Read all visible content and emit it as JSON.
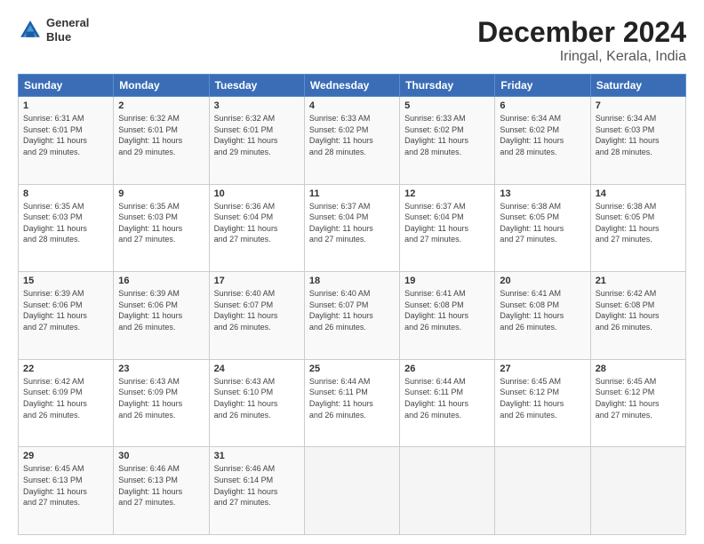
{
  "logo": {
    "line1": "General",
    "line2": "Blue"
  },
  "title": "December 2024",
  "subtitle": "Iringal, Kerala, India",
  "weekdays": [
    "Sunday",
    "Monday",
    "Tuesday",
    "Wednesday",
    "Thursday",
    "Friday",
    "Saturday"
  ],
  "weeks": [
    [
      {
        "day": "1",
        "info": "Sunrise: 6:31 AM\nSunset: 6:01 PM\nDaylight: 11 hours\nand 29 minutes."
      },
      {
        "day": "2",
        "info": "Sunrise: 6:32 AM\nSunset: 6:01 PM\nDaylight: 11 hours\nand 29 minutes."
      },
      {
        "day": "3",
        "info": "Sunrise: 6:32 AM\nSunset: 6:01 PM\nDaylight: 11 hours\nand 29 minutes."
      },
      {
        "day": "4",
        "info": "Sunrise: 6:33 AM\nSunset: 6:02 PM\nDaylight: 11 hours\nand 28 minutes."
      },
      {
        "day": "5",
        "info": "Sunrise: 6:33 AM\nSunset: 6:02 PM\nDaylight: 11 hours\nand 28 minutes."
      },
      {
        "day": "6",
        "info": "Sunrise: 6:34 AM\nSunset: 6:02 PM\nDaylight: 11 hours\nand 28 minutes."
      },
      {
        "day": "7",
        "info": "Sunrise: 6:34 AM\nSunset: 6:03 PM\nDaylight: 11 hours\nand 28 minutes."
      }
    ],
    [
      {
        "day": "8",
        "info": "Sunrise: 6:35 AM\nSunset: 6:03 PM\nDaylight: 11 hours\nand 28 minutes."
      },
      {
        "day": "9",
        "info": "Sunrise: 6:35 AM\nSunset: 6:03 PM\nDaylight: 11 hours\nand 27 minutes."
      },
      {
        "day": "10",
        "info": "Sunrise: 6:36 AM\nSunset: 6:04 PM\nDaylight: 11 hours\nand 27 minutes."
      },
      {
        "day": "11",
        "info": "Sunrise: 6:37 AM\nSunset: 6:04 PM\nDaylight: 11 hours\nand 27 minutes."
      },
      {
        "day": "12",
        "info": "Sunrise: 6:37 AM\nSunset: 6:04 PM\nDaylight: 11 hours\nand 27 minutes."
      },
      {
        "day": "13",
        "info": "Sunrise: 6:38 AM\nSunset: 6:05 PM\nDaylight: 11 hours\nand 27 minutes."
      },
      {
        "day": "14",
        "info": "Sunrise: 6:38 AM\nSunset: 6:05 PM\nDaylight: 11 hours\nand 27 minutes."
      }
    ],
    [
      {
        "day": "15",
        "info": "Sunrise: 6:39 AM\nSunset: 6:06 PM\nDaylight: 11 hours\nand 27 minutes."
      },
      {
        "day": "16",
        "info": "Sunrise: 6:39 AM\nSunset: 6:06 PM\nDaylight: 11 hours\nand 26 minutes."
      },
      {
        "day": "17",
        "info": "Sunrise: 6:40 AM\nSunset: 6:07 PM\nDaylight: 11 hours\nand 26 minutes."
      },
      {
        "day": "18",
        "info": "Sunrise: 6:40 AM\nSunset: 6:07 PM\nDaylight: 11 hours\nand 26 minutes."
      },
      {
        "day": "19",
        "info": "Sunrise: 6:41 AM\nSunset: 6:08 PM\nDaylight: 11 hours\nand 26 minutes."
      },
      {
        "day": "20",
        "info": "Sunrise: 6:41 AM\nSunset: 6:08 PM\nDaylight: 11 hours\nand 26 minutes."
      },
      {
        "day": "21",
        "info": "Sunrise: 6:42 AM\nSunset: 6:08 PM\nDaylight: 11 hours\nand 26 minutes."
      }
    ],
    [
      {
        "day": "22",
        "info": "Sunrise: 6:42 AM\nSunset: 6:09 PM\nDaylight: 11 hours\nand 26 minutes."
      },
      {
        "day": "23",
        "info": "Sunrise: 6:43 AM\nSunset: 6:09 PM\nDaylight: 11 hours\nand 26 minutes."
      },
      {
        "day": "24",
        "info": "Sunrise: 6:43 AM\nSunset: 6:10 PM\nDaylight: 11 hours\nand 26 minutes."
      },
      {
        "day": "25",
        "info": "Sunrise: 6:44 AM\nSunset: 6:11 PM\nDaylight: 11 hours\nand 26 minutes."
      },
      {
        "day": "26",
        "info": "Sunrise: 6:44 AM\nSunset: 6:11 PM\nDaylight: 11 hours\nand 26 minutes."
      },
      {
        "day": "27",
        "info": "Sunrise: 6:45 AM\nSunset: 6:12 PM\nDaylight: 11 hours\nand 26 minutes."
      },
      {
        "day": "28",
        "info": "Sunrise: 6:45 AM\nSunset: 6:12 PM\nDaylight: 11 hours\nand 27 minutes."
      }
    ],
    [
      {
        "day": "29",
        "info": "Sunrise: 6:45 AM\nSunset: 6:13 PM\nDaylight: 11 hours\nand 27 minutes."
      },
      {
        "day": "30",
        "info": "Sunrise: 6:46 AM\nSunset: 6:13 PM\nDaylight: 11 hours\nand 27 minutes."
      },
      {
        "day": "31",
        "info": "Sunrise: 6:46 AM\nSunset: 6:14 PM\nDaylight: 11 hours\nand 27 minutes."
      },
      {
        "day": "",
        "info": ""
      },
      {
        "day": "",
        "info": ""
      },
      {
        "day": "",
        "info": ""
      },
      {
        "day": "",
        "info": ""
      }
    ]
  ]
}
